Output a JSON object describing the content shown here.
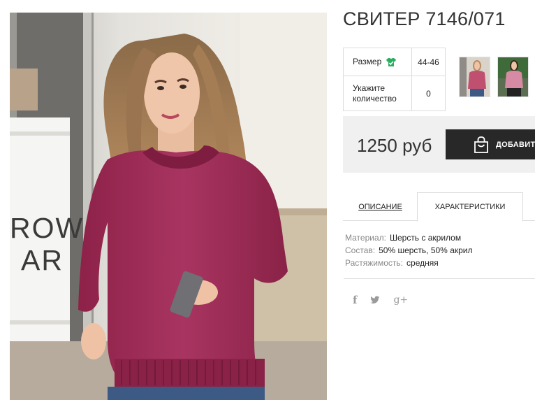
{
  "product": {
    "title": "СВИТЕР 7146/071",
    "params": {
      "size_label": "Размер",
      "size_value": "44-46",
      "qty_label": "Укажите количество",
      "qty_value": "0"
    },
    "price": "1250 руб",
    "buy_label": "ДОБАВИТЬ",
    "tabs": {
      "description": "ОПИСАНИЕ",
      "characteristics": "ХАРАКТЕРИСТИКИ"
    },
    "specs": [
      {
        "key": "Материал:",
        "value": "Шерсть с акрилом"
      },
      {
        "key": "Состав:",
        "value": "50% шерсть, 50% акрил"
      },
      {
        "key": "Растяжимость:",
        "value": "средняя"
      }
    ],
    "photo_sign_text": [
      "ROW",
      "AR"
    ]
  },
  "social": {
    "facebook": "f",
    "twitter": "twitter-icon",
    "google_plus": "g+"
  },
  "colors": {
    "sweater": "#a02c55",
    "dark_button": "#282828",
    "size_icon": "#27ae60",
    "price_bg": "#f0f0f0"
  }
}
